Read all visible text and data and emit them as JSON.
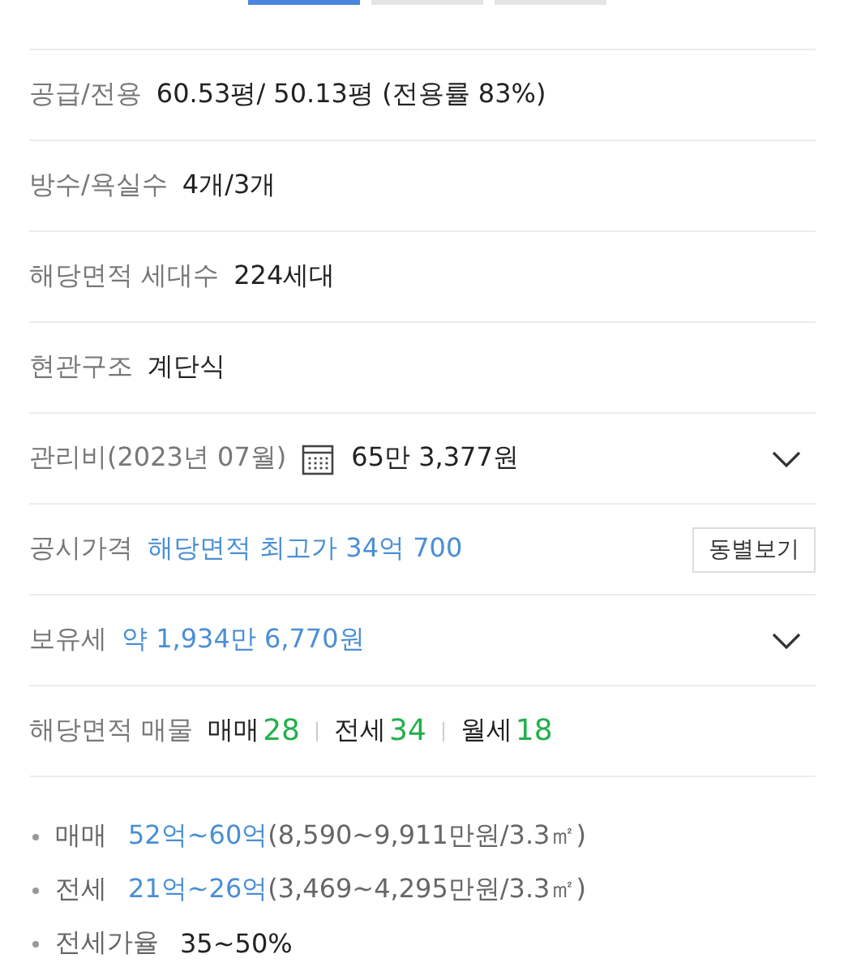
{
  "tabs": [
    {
      "selected": true
    },
    {
      "selected": false
    },
    {
      "selected": false
    }
  ],
  "rows": [
    {
      "kind": "info",
      "label": "공급/전용",
      "value": "60.53평/ 50.13평 (전용률 83%)",
      "color": "#222222"
    },
    {
      "kind": "info",
      "label": "방수/욕실수",
      "value": "4개/3개",
      "color": "#222222"
    },
    {
      "kind": "info",
      "label": "해당면적 세대수",
      "value": "224세대",
      "color": "#222222"
    },
    {
      "kind": "info",
      "label": "현관구조",
      "value": "계단식",
      "color": "#222222"
    },
    {
      "kind": "info",
      "label": "관리비(2023년 07월)",
      "calendar": true,
      "value": "65만 3,377원",
      "color": "#222222",
      "expanded": false
    },
    {
      "kind": "info",
      "label": "공시가격",
      "value": "해당면적 최고가 34억 700",
      "color": "#4a8fd4",
      "button": "동별보기"
    },
    {
      "kind": "info",
      "label": "보유세",
      "value": "약 1,934만 6,770원",
      "color": "#4a8fd4",
      "expanded": false
    },
    {
      "kind": "listings",
      "label": "해당면적 매물",
      "items": [
        {
          "label": "매매",
          "count": "28"
        },
        {
          "label": "전세",
          "count": "34"
        },
        {
          "label": "월세",
          "count": "18"
        }
      ]
    }
  ],
  "prices": [
    {
      "kind": "range",
      "label": "매매",
      "range": "52억~60억",
      "detail": "(8,590~9,911만원/3.3㎡)"
    },
    {
      "kind": "range",
      "label": "전세",
      "range": "21억~26억",
      "detail": "(3,469~4,295만원/3.3㎡)"
    },
    {
      "kind": "plain",
      "label": "전세가율",
      "value": "35~50%"
    }
  ]
}
